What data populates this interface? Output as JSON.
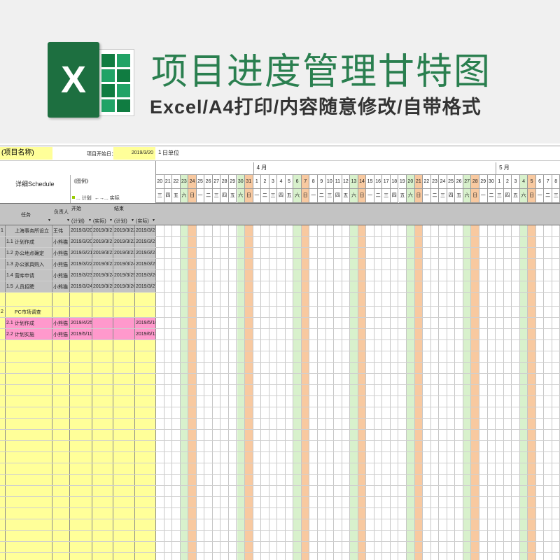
{
  "banner": {
    "title": "项目进度管理甘特图",
    "subtitle": "Excel/A4打印/内容随意修改/自带格式",
    "logo_letter": "X",
    "logo_icon": "excel-icon"
  },
  "project": {
    "name": "(项目名称)",
    "start_label": "项目开始日：",
    "start_value": "2019/3/20",
    "unit_value": "1",
    "unit_label": "日单位"
  },
  "header": {
    "schedule_label": "详细Schedule",
    "legend_title": "《图例》",
    "legend_plan": "... 计划",
    "legend_actual": "←→... 实际"
  },
  "columns": {
    "task": "任务",
    "owner": "负责人",
    "start": "开始",
    "end": "结束",
    "plan": "(计划)",
    "actual": "(实际)",
    "filter_icon": "dropdown-arrow-icon"
  },
  "calendar": {
    "months": [
      "4 月",
      "5 月"
    ],
    "days": [
      "20",
      "21",
      "22",
      "23",
      "24",
      "25",
      "26",
      "27",
      "28",
      "29",
      "30",
      "31",
      "1",
      "2",
      "3",
      "4",
      "5",
      "6",
      "7",
      "8",
      "9",
      "10",
      "11",
      "12",
      "13",
      "14",
      "15",
      "16",
      "17",
      "18",
      "19",
      "20",
      "21",
      "22",
      "23",
      "24",
      "25",
      "26",
      "27",
      "28",
      "29",
      "30",
      "1",
      "2",
      "3",
      "4",
      "5",
      "6",
      "7",
      "8"
    ],
    "weekdays": [
      "三",
      "四",
      "五",
      "六",
      "日",
      "一",
      "二",
      "三",
      "四",
      "五",
      "六",
      "日",
      "一",
      "二",
      "三",
      "四",
      "五",
      "六",
      "日",
      "一",
      "二",
      "三",
      "四",
      "五",
      "六",
      "日",
      "一",
      "二",
      "三",
      "四",
      "五",
      "六",
      "日",
      "一",
      "二",
      "三",
      "四",
      "五",
      "六",
      "日",
      "一",
      "二",
      "三",
      "四",
      "五",
      "六",
      "日",
      "一",
      "二",
      "三"
    ]
  },
  "tasks": [
    {
      "num": "1",
      "id": "",
      "name": "上海事务所设立",
      "owner": "王伟",
      "plan_start": "2019/3/20",
      "actual_start": "2019/3/21",
      "plan_end": "2019/3/22",
      "actual_end": "2019/3/23",
      "fill": "gray"
    },
    {
      "num": "",
      "id": "1.1",
      "name": "计划作成",
      "owner": "小熊猫",
      "plan_start": "2019/3/20",
      "actual_start": "2019/3/21",
      "plan_end": "2019/3/22",
      "actual_end": "2019/3/23",
      "fill": "gray"
    },
    {
      "num": "",
      "id": "1.2",
      "name": "办公地点确定",
      "owner": "小熊猫",
      "plan_start": "2019/3/21",
      "actual_start": "2019/3/22",
      "plan_end": "2019/3/23",
      "actual_end": "2019/3/24",
      "fill": "gray"
    },
    {
      "num": "",
      "id": "1.3",
      "name": "办公家具购入",
      "owner": "小熊猫",
      "plan_start": "2019/3/22",
      "actual_start": "2019/3/23",
      "plan_end": "2019/3/24",
      "actual_end": "2019/3/25",
      "fill": "gray"
    },
    {
      "num": "",
      "id": "1.4",
      "name": "营库申请",
      "owner": "小熊猫",
      "plan_start": "2019/3/23",
      "actual_start": "2019/3/24",
      "plan_end": "2019/3/25",
      "actual_end": "2019/3/26",
      "fill": "gray"
    },
    {
      "num": "",
      "id": "1.5",
      "name": "人员招聘",
      "owner": "小熊猫",
      "plan_start": "2019/3/24",
      "actual_start": "2019/3/25",
      "plan_end": "2019/3/26",
      "actual_end": "2019/3/27",
      "fill": "gray"
    },
    {
      "num": "",
      "id": "",
      "name": "",
      "owner": "",
      "plan_start": "",
      "actual_start": "",
      "plan_end": "",
      "actual_end": "",
      "fill": "yellow",
      "blank": true
    },
    {
      "num": "2",
      "id": "",
      "name": "PC市场调查",
      "owner": "",
      "plan_start": "",
      "actual_start": "",
      "plan_end": "",
      "actual_end": "",
      "fill": "yellow"
    },
    {
      "num": "",
      "id": "2.1",
      "name": "计划作成",
      "owner": "小熊猫",
      "plan_start": "2019/4/25",
      "actual_start": "",
      "plan_end": "",
      "actual_end": "2019/5/10",
      "fill": "pink"
    },
    {
      "num": "",
      "id": "2.2",
      "name": "计划实施",
      "owner": "小熊猫",
      "plan_start": "2019/5/11",
      "actual_start": "",
      "plan_end": "",
      "actual_end": "2019/6/11",
      "fill": "pink"
    }
  ],
  "marks": {
    "first": "←",
    "middle": "·",
    "last": "→"
  },
  "colors": {
    "brand_green": "#2a7f4f",
    "bar": "#99cc00",
    "saturday": "#d8f1cc",
    "sunday": "#f8c9a0",
    "gray": "#c3c3c3",
    "yellow": "#ffff99",
    "pink": "#ff99cc"
  }
}
